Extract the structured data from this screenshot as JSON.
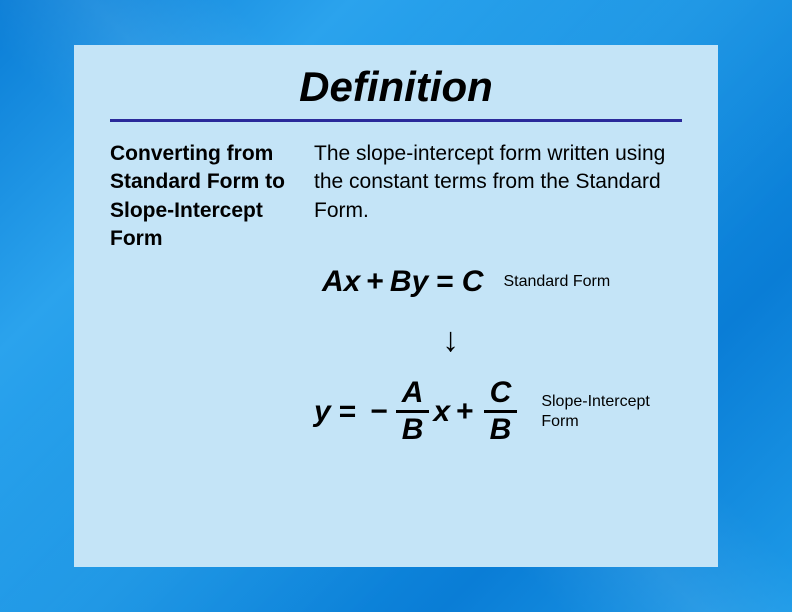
{
  "title": "Definition",
  "term": "Converting from Standard Form to Slope-Intercept Form",
  "description": "The slope-intercept form written using the constant terms from the Standard Form.",
  "equation1": {
    "A": "A",
    "x": "x",
    "plus": "+",
    "B": "B",
    "y": "y",
    "eq": "=",
    "C": "C",
    "label": "Standard Form"
  },
  "arrow": "↓",
  "equation2": {
    "y": "y",
    "eq": "=",
    "neg": "−",
    "frac1_num": "A",
    "frac1_den": "B",
    "x": "x",
    "plus": "+",
    "frac2_num": "C",
    "frac2_den": "B",
    "label": "Slope-Intercept Form"
  }
}
